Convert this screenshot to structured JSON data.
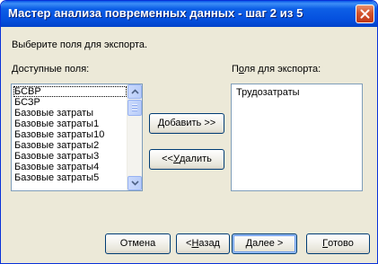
{
  "window": {
    "title": "Мастер анализа повременных данных - шаг 2 из 5"
  },
  "instruction": "Выберите поля для экспорта.",
  "available": {
    "label_accel": "Д",
    "label_rest": "оступные поля:",
    "items": [
      "БСВР",
      "БСЗР",
      "Базовые затраты",
      "Базовые затраты1",
      "Базовые затраты10",
      "Базовые затраты2",
      "Базовые затраты3",
      "Базовые затраты4",
      "Базовые затраты5"
    ]
  },
  "export": {
    "label_pre": "П",
    "label_accel": "о",
    "label_rest": "ля для экспорта:",
    "items": [
      "Трудозатраты"
    ]
  },
  "buttons": {
    "add_accel": "Д",
    "add_rest": "обавить >>",
    "remove_pre": "<< ",
    "remove_accel": "У",
    "remove_rest": "далить",
    "cancel": "Отмена",
    "back_pre": "< ",
    "back_accel": "Н",
    "back_rest": "азад",
    "next_accel": "Д",
    "next_rest": "алее >",
    "finish_accel": "Г",
    "finish_rest": "отово"
  },
  "icons": {
    "close": "close-icon",
    "scroll_up": "arrow-up-icon",
    "scroll_down": "arrow-down-icon"
  }
}
